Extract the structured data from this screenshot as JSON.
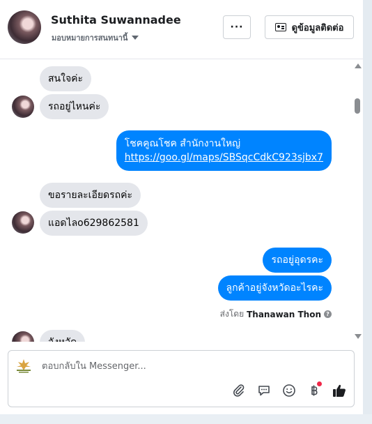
{
  "header": {
    "contact_name": "Suthita Suwannadee",
    "assign_label": "มอบหมายการสนทนานี้",
    "more_label": "···",
    "contact_info_label": "ดูข้อมูลติดต่อ"
  },
  "messages": [
    {
      "direction": "in",
      "text": "สนใจค่ะ"
    },
    {
      "direction": "in",
      "text": "รถอยู่ไหนค่ะ"
    },
    {
      "direction": "out",
      "text": "โชคคูณโชค สำนักงานใหญ่",
      "link": "https://goo.gl/maps/SBSqcCdkC923sjbx7"
    },
    {
      "direction": "in",
      "text": "ขอรายละเอียดรถค่ะ"
    },
    {
      "direction": "in",
      "text": "แอดไลo629862581"
    },
    {
      "direction": "out",
      "text": "รถอยู่อุดรคะ"
    },
    {
      "direction": "out",
      "text": "ลูกค้าอยู่จังหวัดอะไรคะ"
    },
    {
      "direction": "in",
      "text": "จังหวัด"
    }
  ],
  "sent_by": {
    "prefix": "ส่งโดย",
    "name": "Thanawan Thon",
    "help": "?"
  },
  "composer": {
    "placeholder": "ตอบกลับใน Messenger...",
    "value": ""
  },
  "toolbar_icons": [
    "paperclip-icon",
    "saved-reply-icon",
    "emoji-icon",
    "baht-payment-icon",
    "thumbs-up-icon"
  ],
  "colors": {
    "outgoing_bubble": "#0084ff",
    "incoming_bubble": "#e4e6eb",
    "notification_dot": "#f02849"
  }
}
